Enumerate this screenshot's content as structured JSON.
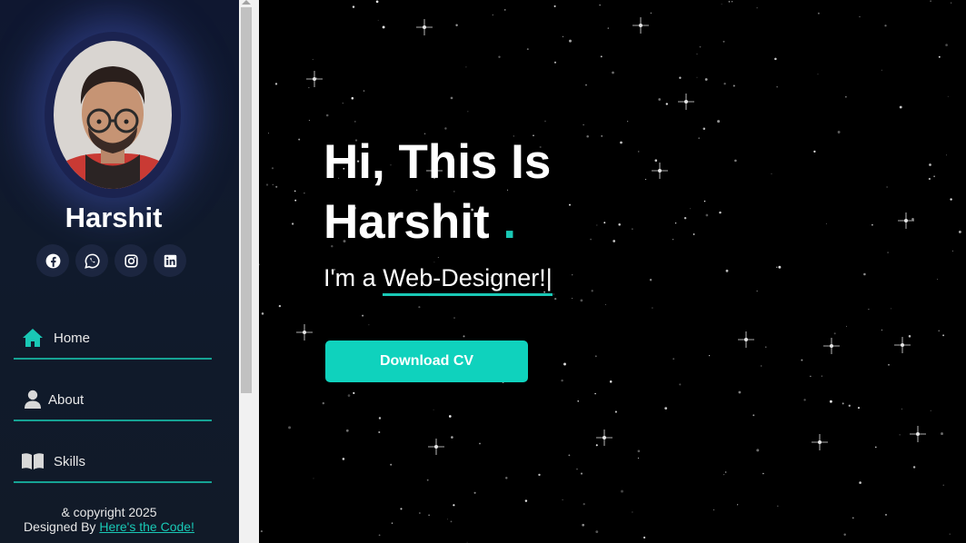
{
  "profile": {
    "name": "Harshit"
  },
  "socials": [
    {
      "icon": "facebook-icon"
    },
    {
      "icon": "whatsapp-icon"
    },
    {
      "icon": "instagram-icon"
    },
    {
      "icon": "linkedin-icon"
    }
  ],
  "nav": {
    "home": "Home",
    "about": "About",
    "skills": "Skills"
  },
  "footer": {
    "copyright": "& copyright 2025",
    "designed_by": "Designed By",
    "link_text": "Here's the Code!"
  },
  "hero": {
    "line1": "Hi, This Is",
    "line2": "Harshit",
    "dot": ".",
    "intro": "I'm a",
    "role": "Web-Designer!",
    "caret": "|",
    "cta": "Download CV"
  },
  "colors": {
    "accent": "#19c8b5",
    "sidebar_bg": "#111a28",
    "button": "#0fd2bd",
    "background": "#000000"
  }
}
